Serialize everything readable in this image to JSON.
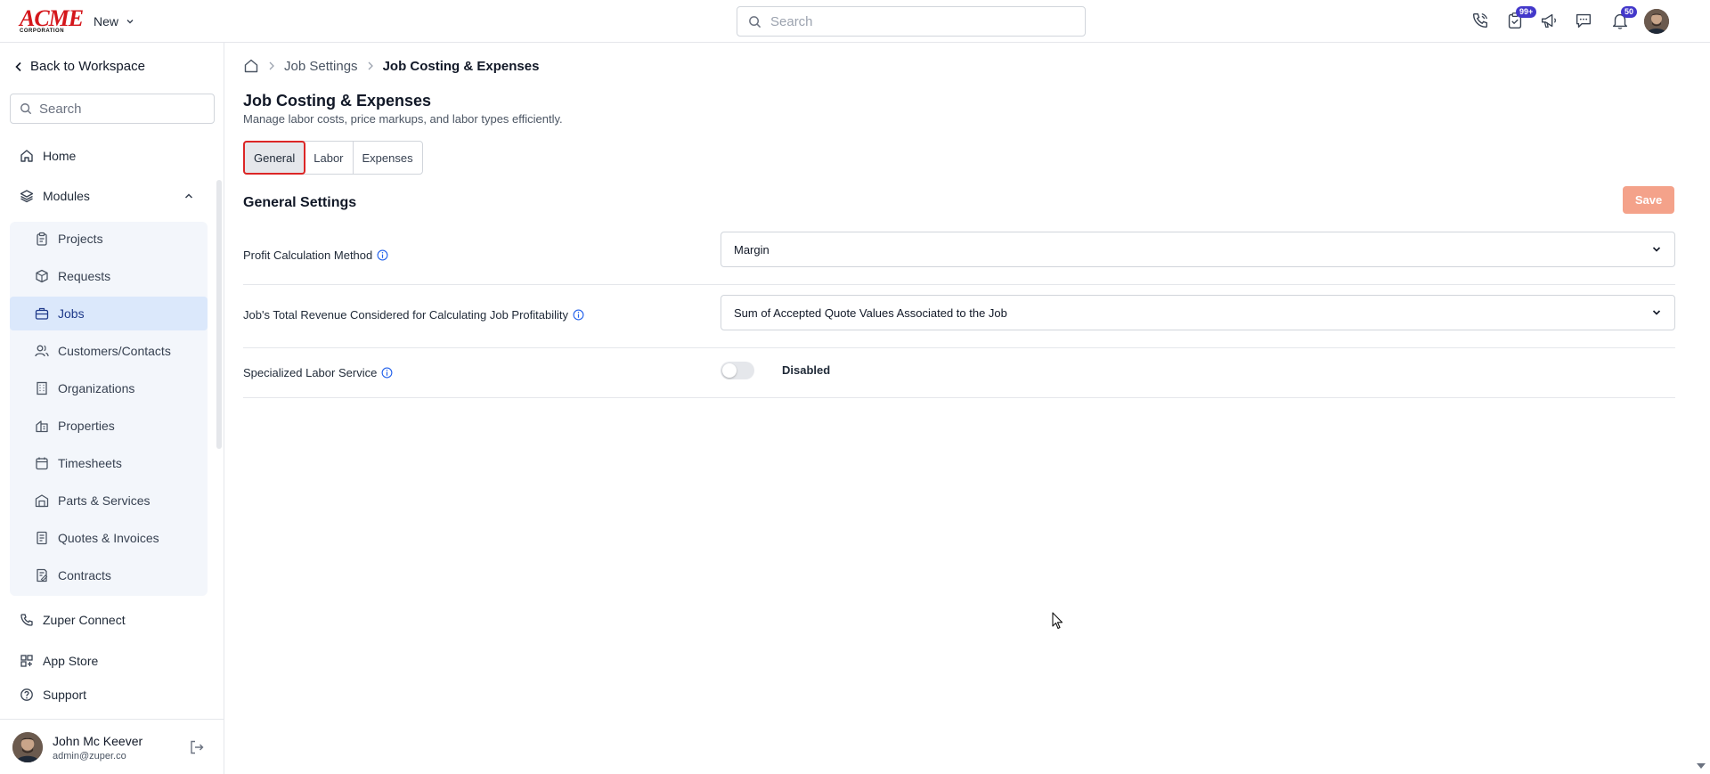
{
  "topbar": {
    "logo_text": "ACME",
    "logo_sub": "CORPORATION",
    "new_label": "New",
    "search_placeholder": "Search",
    "tasks_badge": "99+",
    "notifications_badge": "50"
  },
  "sidebar": {
    "back_label": "Back to Workspace",
    "search_placeholder": "Search",
    "home_label": "Home",
    "modules_label": "Modules",
    "modules": [
      {
        "label": "Projects",
        "icon": "clipboard-icon"
      },
      {
        "label": "Requests",
        "icon": "box-icon"
      },
      {
        "label": "Jobs",
        "icon": "briefcase-icon",
        "active": true
      },
      {
        "label": "Customers/Contacts",
        "icon": "users-icon"
      },
      {
        "label": "Organizations",
        "icon": "building-icon"
      },
      {
        "label": "Properties",
        "icon": "property-icon"
      },
      {
        "label": "Timesheets",
        "icon": "calendar-icon"
      },
      {
        "label": "Parts & Services",
        "icon": "warehouse-icon"
      },
      {
        "label": "Quotes & Invoices",
        "icon": "invoice-icon"
      },
      {
        "label": "Contracts",
        "icon": "contract-icon"
      }
    ],
    "zuper_connect_label": "Zuper Connect",
    "app_store_label": "App Store",
    "support_label": "Support",
    "user": {
      "name": "John Mc Keever",
      "email": "admin@zuper.co"
    }
  },
  "main": {
    "breadcrumb": [
      "Job Settings",
      "Job Costing & Expenses"
    ],
    "title": "Job Costing & Expenses",
    "subtitle": "Manage labor costs, price markups, and labor types efficiently.",
    "tabs": [
      "General",
      "Labor",
      "Expenses"
    ],
    "active_tab": "General",
    "section_title": "General Settings",
    "save_label": "Save",
    "settings": {
      "profit_method_label": "Profit Calculation Method",
      "profit_method_value": "Margin",
      "revenue_label": "Job's Total Revenue Considered for Calculating Job Profitability",
      "revenue_value": "Sum of Accepted Quote Values Associated to the Job",
      "specialized_label": "Specialized Labor Service",
      "specialized_state": "Disabled"
    }
  },
  "colors": {
    "accent": "#2563eb",
    "active_tab_border": "#dc2626",
    "save_button": "#f4a28a",
    "badge": "#4338ca",
    "active_nav_bg": "#dbe8fb"
  }
}
